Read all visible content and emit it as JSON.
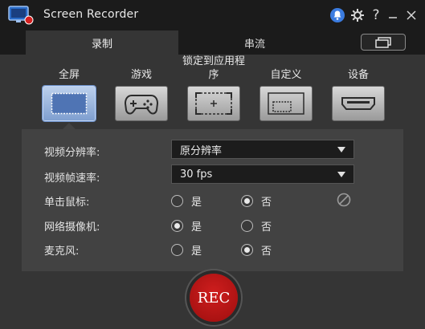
{
  "app": {
    "title": "Screen Recorder"
  },
  "icons": {
    "app": "screen-recorder-icon",
    "notification": "bell-icon",
    "settings": "gear-icon",
    "help": "?",
    "minimize": "minimize-icon",
    "close": "close-icon",
    "mini_mode": "mini-mode-icon",
    "click_blocked": "disabled-icon"
  },
  "tabs": [
    {
      "label": "录制",
      "active": true
    },
    {
      "label": "串流",
      "active": false
    }
  ],
  "modes": [
    {
      "label": "全屏",
      "icon": "fullscreen-icon",
      "selected": true
    },
    {
      "label": "游戏",
      "icon": "gamepad-icon",
      "selected": false
    },
    {
      "label_line1": "锁定到应用程",
      "label_line2": "序",
      "icon": "lock-to-app-icon",
      "selected": false
    },
    {
      "label": "自定义",
      "icon": "custom-region-icon",
      "selected": false
    },
    {
      "label": "设备",
      "icon": "hdmi-device-icon",
      "selected": false
    }
  ],
  "settings": {
    "resolution": {
      "label": "视频分辨率:",
      "value": "原分辨率"
    },
    "framerate": {
      "label": "视频帧速率:",
      "value": "30 fps"
    },
    "mouse_click": {
      "label": "单击鼠标:",
      "yes": "是",
      "no": "否",
      "selected": "no"
    },
    "webcam": {
      "label": "网络摄像机:",
      "yes": "是",
      "no": "否",
      "selected": "yes"
    },
    "microphone": {
      "label": "麦克风:",
      "yes": "是",
      "no": "否",
      "selected": "no"
    }
  },
  "rec_button": {
    "label": "REC"
  },
  "colors": {
    "accent_badge": "#3b7ce0",
    "rec_red": "#b51414",
    "selected_mode": "#7f9fd0"
  }
}
